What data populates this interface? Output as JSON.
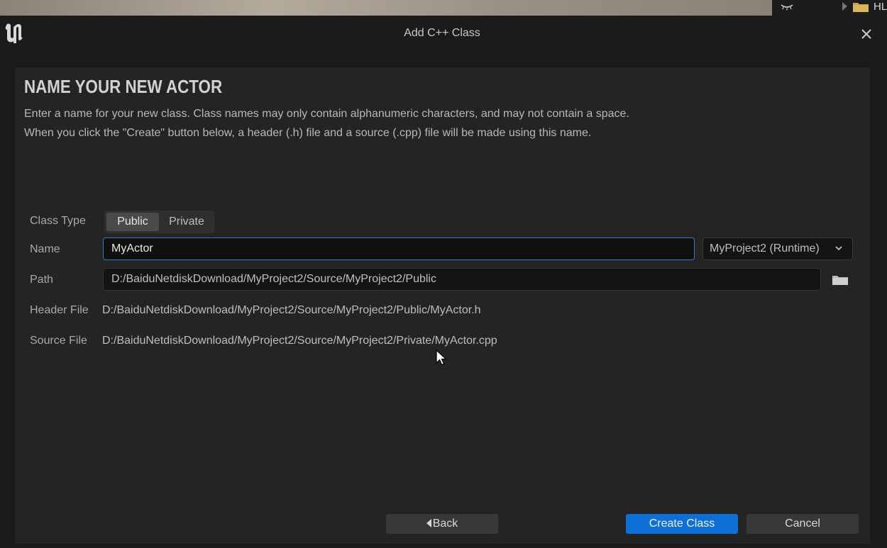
{
  "background": {
    "strip_label": "HL",
    "eye_icon": "eye-closed-icon",
    "folder_icon": "folder-icon"
  },
  "window": {
    "title": "Add C++ Class",
    "logo_icon": "unreal-engine-logo-icon",
    "close_icon": "close-icon"
  },
  "page": {
    "heading": "NAME YOUR NEW ACTOR",
    "description_line1": "Enter a name for your new class. Class names may only contain alphanumeric characters, and may not contain a space.",
    "description_line2": "When you click the \"Create\" button below, a header (.h) file and a source (.cpp) file will be made using this name."
  },
  "form": {
    "class_type": {
      "label": "Class Type",
      "options": [
        "Public",
        "Private"
      ],
      "selected": "Public"
    },
    "name": {
      "label": "Name",
      "value": "MyActor",
      "module": "MyProject2 (Runtime)"
    },
    "path": {
      "label": "Path",
      "value": "D:/BaiduNetdiskDownload/MyProject2/Source/MyProject2/Public"
    },
    "header_file": {
      "label": "Header File",
      "value": "D:/BaiduNetdiskDownload/MyProject2/Source/MyProject2/Public/MyActor.h"
    },
    "source_file": {
      "label": "Source File",
      "value": "D:/BaiduNetdiskDownload/MyProject2/Source/MyProject2/Private/MyActor.cpp"
    }
  },
  "buttons": {
    "back": "Back",
    "create": "Create Class",
    "cancel": "Cancel"
  },
  "colors": {
    "accent": "#0e6fd6",
    "input_focus_border": "#2f77c8",
    "panel_bg": "#242424"
  }
}
